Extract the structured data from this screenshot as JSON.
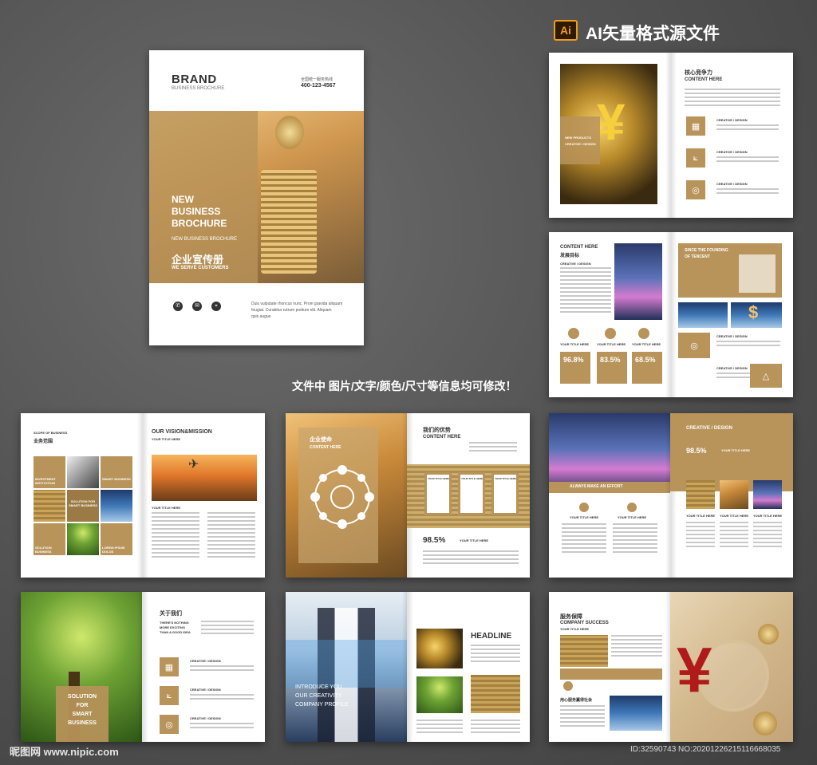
{
  "banner": {
    "ai_badge": "Ai",
    "title": "AI矢量格式源文件"
  },
  "note": "文件中 图片/文字/颜色/尺寸等信息均可修改！",
  "cover": {
    "brand": "BRAND",
    "brand_sub": "BUSINESS BROCHURE",
    "hotline_label": "全国统一服务热线",
    "hotline": "400-123-4567",
    "headline_1": "NEW",
    "headline_2": "BUSINESS",
    "headline_3": "BROCHURE",
    "headline_sub": "NEW BUSINESS BROCHURE",
    "cn_title": "企业宣传册",
    "serve": "WE SERVE CUSTOMERS",
    "footer_text_1": "Duis vulputate rhoncus nunc. Proin gravida aliquam",
    "footer_text_2": "feugiat. Curabitur rutrum pretium elit. Aliquam",
    "footer_text_3": "quis augue"
  },
  "spread1": {
    "cn_title": "核心竞争力",
    "en_title": "CONTENT HERE",
    "photo_label_1": "NEW PRODUCTS",
    "photo_label_2": "CREATIVE / DESIGN",
    "items": [
      "CREATIVE / DESIGN",
      "CREATIVE / DESIGN",
      "CREATIVE / DESIGN"
    ]
  },
  "spread2": {
    "en_title": "CONTENT HERE",
    "cn_title": "发展目标",
    "sub": "CREATIVE / DESIGN",
    "box_title_1": "SINCE THE FOUNDING",
    "box_title_2": "OF TENCENT",
    "stats": [
      "96.8%",
      "83.5%",
      "68.5%"
    ],
    "stat_labels": [
      "YOUR TITLE HERE",
      "YOUR TITLE HERE",
      "YOUR TITLE HERE"
    ],
    "side_labels": [
      "CREATIVE / DESIGN",
      "CREATIVE / DESIGN"
    ]
  },
  "spread3": {
    "scope": "SCOPE OF BUSINESS",
    "cn": "业务范围",
    "vision": "OUR VISION&MISSION",
    "your_title": "YOUR TITLE HERE",
    "cells": [
      "INVESTMENT INSTITUTION",
      "SMART BUSINESS",
      "SOLUTION FOR SMART BUSINESS",
      "SOLUTION BUSINESS",
      "LOREM IPSUM DOLOS"
    ],
    "your_title_2": "YOUR TITLE HERE"
  },
  "spread4": {
    "cn_title": "企业使命",
    "en_title": "CONTENT HERE",
    "cn_right": "我们的优势",
    "en_right": "CONTENT HERE",
    "stat": "98.5%",
    "stat_label": "YOUR TITLE HERE",
    "box_labels": [
      "YOUR TITLE HERE",
      "YOUR TITLE HERE",
      "YOUR TITLE HERE"
    ]
  },
  "spread5": {
    "effort": "ALWAYS MAKE AN EFFORT",
    "creative": "CREATIVE / DESIGN",
    "stat": "98.5%",
    "your_title": "YOUR TITLE HERE",
    "labels": [
      "YOUR TITLE HERE",
      "YOUR TITLE HERE",
      "YOUR TITLE HERE",
      "YOUR TITLE HERE",
      "YOUR TITLE HERE"
    ]
  },
  "spread6": {
    "box_1": "SOLUTION",
    "box_2": "FOR",
    "box_3": "SMART",
    "box_4": "BUSINESS",
    "cn_title": "关于我们",
    "lead_1": "THERE'S NOTHING",
    "lead_2": "MORE EXCITING",
    "lead_3": "THAN A GOOD IDEA",
    "items": [
      "CREATIVE / DESIGN",
      "CREATIVE / DESIGN",
      "CREATIVE / DESIGN"
    ]
  },
  "spread7": {
    "intro_1": "INTRODUCE YOU",
    "intro_2": "OUR CREATIVITY",
    "intro_3": "COMPANY PROFILE",
    "headline": "HEADLINE"
  },
  "spread8": {
    "cn_title": "服务保障",
    "en_title": "COMPANY SUCCESS",
    "your_title": "YOUR TITLE HERE",
    "cn_sub": "用心服务赢得社会"
  },
  "watermark": {
    "left": "昵图网 www.nipic.com",
    "right": "ID:32590743 NO:20201226215116668035"
  },
  "colors": {
    "accent": "#b8935a",
    "background": "#555555"
  }
}
